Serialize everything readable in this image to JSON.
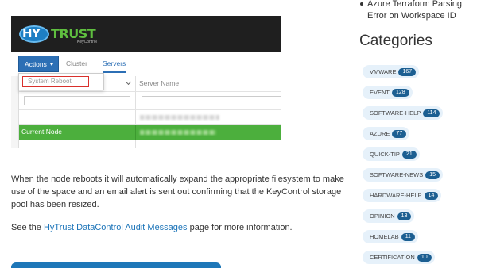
{
  "figure": {
    "logo": {
      "hy": "HY",
      "trust": "TRUST",
      "sub": "KeyControl"
    },
    "actions_label": "Actions",
    "tabs": [
      {
        "label": "Cluster"
      },
      {
        "label": "Servers"
      }
    ],
    "dropdown_item": "System Reboot",
    "column_header": "Server Name",
    "current_node_label": "Current Node"
  },
  "article": {
    "para1": "When the node reboots it will automatically expand the appropriate filesystem to make use of the space and an email alert is sent out confirming that the KeyControl storage pool has been resized.",
    "para2_prefix": "See the ",
    "para2_link": "HyTrust DataControl Audit Messages",
    "para2_suffix": " page for more information."
  },
  "sidebar": {
    "recent_post": "Azure Terraform Parsing Error on Workspace ID",
    "categories_heading": "Categories",
    "categories": [
      {
        "name": "VMWARE",
        "count": "167"
      },
      {
        "name": "EVENT",
        "count": "128"
      },
      {
        "name": "SOFTWARE-HELP",
        "count": "114"
      },
      {
        "name": "AZURE",
        "count": "77"
      },
      {
        "name": "QUICK-TIP",
        "count": "21"
      },
      {
        "name": "SOFTWARE-NEWS",
        "count": "15"
      },
      {
        "name": "HARDWARE-HELP",
        "count": "14"
      },
      {
        "name": "OPINION",
        "count": "13"
      },
      {
        "name": "HOMELAB",
        "count": "11"
      },
      {
        "name": "CERTIFICATION",
        "count": "10"
      }
    ]
  },
  "colors": {
    "accent_blue": "#1e77b8",
    "success_green": "#4caf3d",
    "highlight_red": "#d9302c",
    "tag_bg": "#e6f1fa",
    "badge_bg": "#1c5f92"
  }
}
